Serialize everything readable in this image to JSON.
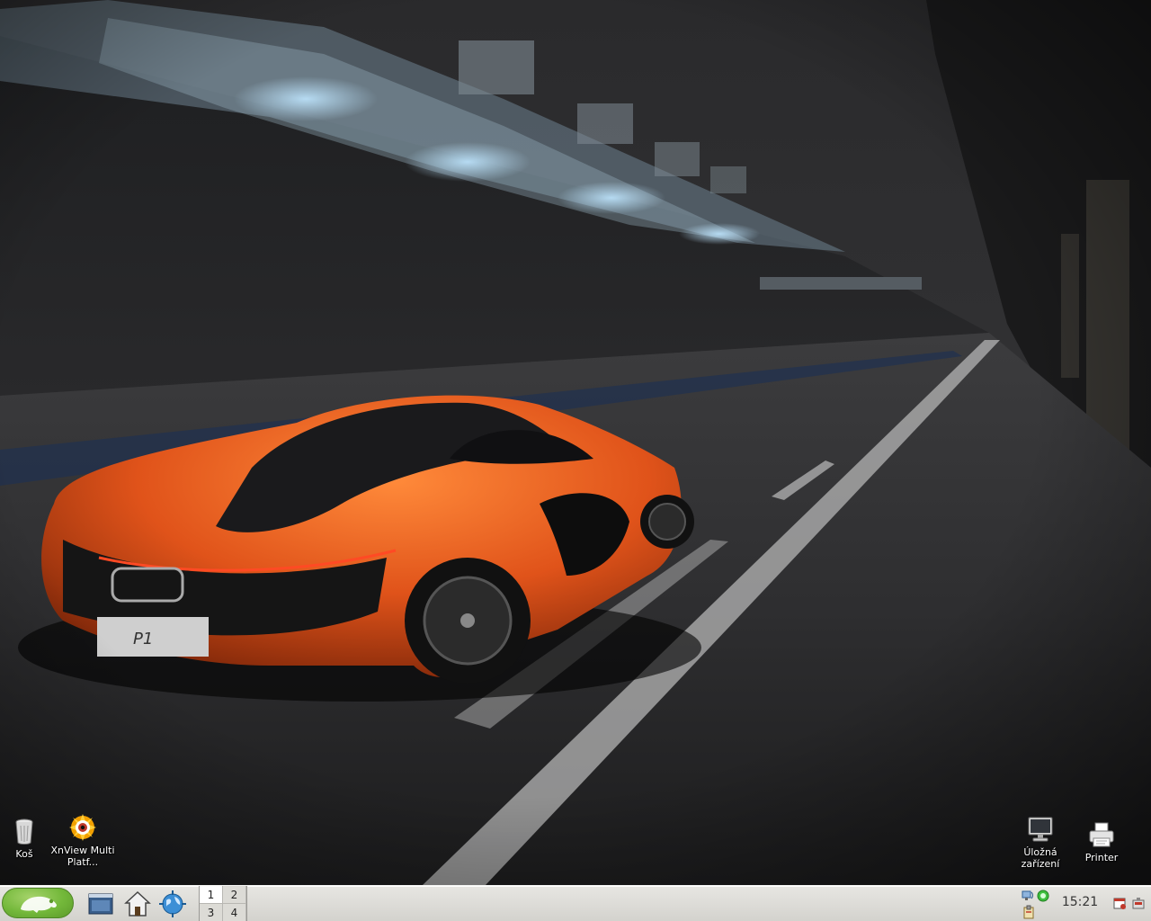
{
  "desktop": {
    "icons": [
      {
        "name": "Koš",
        "icon": "trash-icon"
      },
      {
        "name": "XnView Multi Platf...",
        "icon": "xnview-icon"
      },
      {
        "name": "Úložná zařízení",
        "icon": "monitor-icon"
      },
      {
        "name": "Printer",
        "icon": "printer-icon"
      }
    ]
  },
  "taskbar": {
    "start_icon": "opensuse-gecko-icon",
    "launchers": [
      "show-desktop-icon",
      "home-folder-icon",
      "browser-icon"
    ],
    "pager": [
      "1",
      "2",
      "3",
      "4"
    ],
    "active_workspace": "1",
    "clock": "15:21",
    "tray": [
      "network-icon",
      "update-icon",
      "clipboard-icon",
      "screenshot-icon",
      "power-icon"
    ]
  },
  "colors": {
    "taskbar_bg": "#dddcd7",
    "start_green": "#73b83a",
    "car_orange": "#e0531a"
  }
}
